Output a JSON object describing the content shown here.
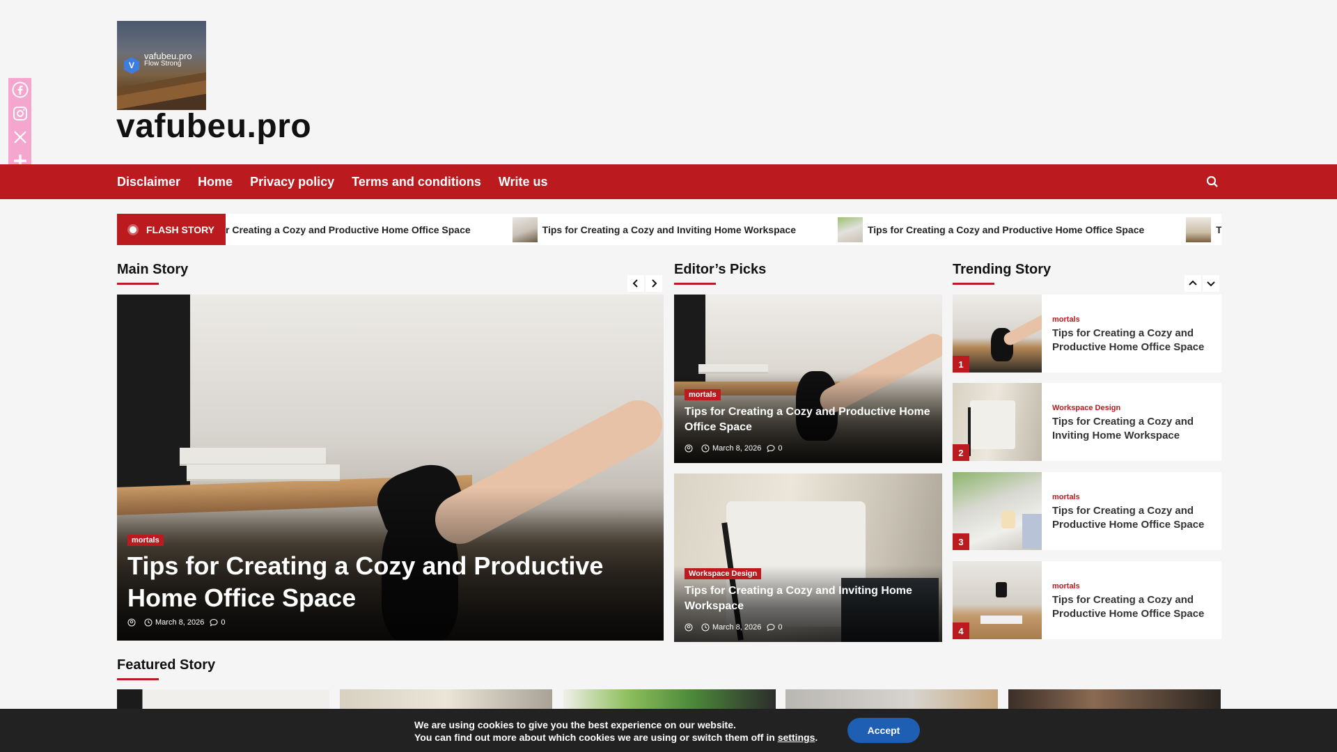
{
  "site": {
    "logo_name": "vafubeu.pro",
    "logo_tagline": "Flow Strong",
    "logo_badge": "V",
    "title": "vafubeu.pro"
  },
  "nav": {
    "items": [
      "Disclaimer",
      "Home",
      "Privacy policy",
      "Terms and conditions",
      "Write us"
    ]
  },
  "flash": {
    "label": "FLASH STORY",
    "items": [
      "r Creating a Cozy and Productive Home Office Space",
      "Tips for Creating a Cozy and Inviting Home Workspace",
      "Tips for Creating a Cozy and Productive Home Office Space",
      "T"
    ]
  },
  "sections": {
    "main": "Main Story",
    "editors": "Editor’s Picks",
    "trending": "Trending Story",
    "featured": "Featured Story"
  },
  "main_story": {
    "category": "mortals",
    "title": "Tips for Creating a Cozy and Productive Home Office Space",
    "date": "March 8, 2026",
    "comments": "0"
  },
  "picks": [
    {
      "category": "mortals",
      "title": "Tips for Creating a Cozy and Productive Home Office Space",
      "date": "March 8, 2026",
      "comments": "0"
    },
    {
      "category": "Workspace Design",
      "title": "Tips for Creating a Cozy and Inviting Home Workspace",
      "date": "March 8, 2026",
      "comments": "0"
    }
  ],
  "trending": [
    {
      "num": "1",
      "category": "mortals",
      "title": "Tips for Creating a Cozy and Productive Home Office Space"
    },
    {
      "num": "2",
      "category": "Workspace Design",
      "title": "Tips for Creating a Cozy and Inviting Home Workspace"
    },
    {
      "num": "3",
      "category": "mortals",
      "title": "Tips for Creating a Cozy and Productive Home Office Space"
    },
    {
      "num": "4",
      "category": "mortals",
      "title": "Tips for Creating a Cozy and Productive Home Office Space"
    }
  ],
  "cookie": {
    "line1": "We are using cookies to give you the best experience on our website.",
    "line2_pre": "You can find out more about which cookies we are using or switch them off in ",
    "line2_link": "settings",
    "line2_post": ".",
    "accept": "Accept"
  },
  "icons": {
    "social": [
      "facebook-icon",
      "instagram-icon",
      "x-icon",
      "plus-share-icon"
    ],
    "nav_search": "search-icon"
  },
  "colors": {
    "brand_red": "#bb1a1e",
    "share_pink": "#f4a6cf",
    "accept_blue": "#1e5fb4"
  }
}
